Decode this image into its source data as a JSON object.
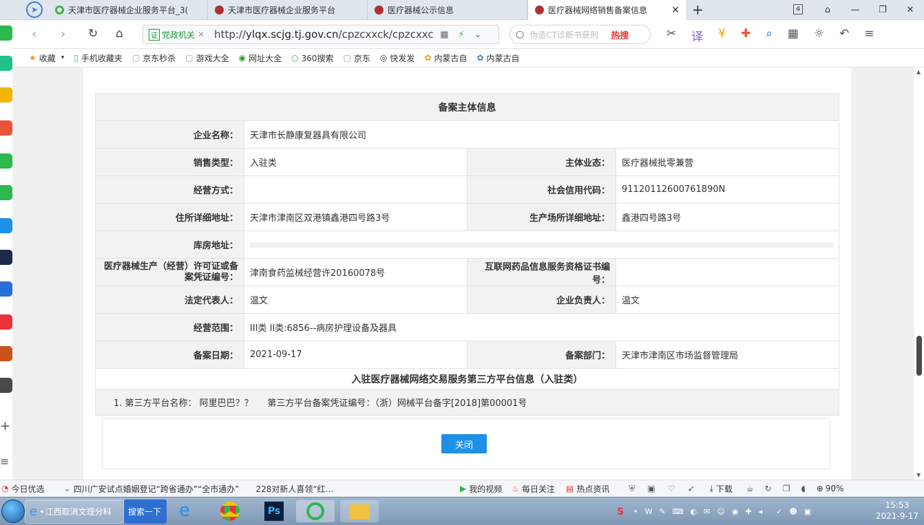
{
  "browser": {
    "tabs": [
      {
        "label": "天津市医疗器械企业服务平台_3(",
        "icon": "green-circle-icon",
        "active": false
      },
      {
        "label": "天津市医疗器械企业服务平台",
        "icon": "gov-emblem-icon",
        "active": false
      },
      {
        "label": "医疗器械公示信息",
        "icon": "gov-emblem-icon",
        "active": false
      },
      {
        "label": "医疗器械网络销售备案信息",
        "icon": "gov-emblem-icon",
        "active": true
      }
    ],
    "tab_count": "4",
    "cert_label": "党政机关",
    "url_prefix": "http://",
    "url_domain": "ylqx.scjg.tj.gov.cn",
    "url_path": "/cpzcxxck/cpzcxxckActio",
    "search_placeholder": "伪造CT诊断书获刑",
    "search_hot": "热搜",
    "bookmarks": [
      {
        "label": "收藏",
        "icon": "star-icon"
      },
      {
        "label": "手机收藏夹",
        "icon": "phone-icon"
      },
      {
        "label": "京东秒杀",
        "icon": "page-icon"
      },
      {
        "label": "游戏大全",
        "icon": "page-icon"
      },
      {
        "label": "网址大全",
        "icon": "globe-icon"
      },
      {
        "label": "360搜索",
        "icon": "search-360-icon"
      },
      {
        "label": "京东",
        "icon": "page-icon"
      },
      {
        "label": "快发发",
        "icon": "kuaifa-icon"
      },
      {
        "label": "内蒙古自",
        "icon": "flower-icon"
      },
      {
        "label": "内蒙古自",
        "icon": "flower-icon"
      }
    ]
  },
  "record": {
    "title": "备案主体信息",
    "company_name_label": "企业名称：",
    "company_name": "天津市长静康复器具有限公司",
    "sales_type_label": "销售类型：",
    "sales_type": "入驻类",
    "business_type_label": "主体业态：",
    "business_type": "医疗器械批零兼营",
    "operation_mode_label": "经营方式：",
    "operation_mode": "",
    "credit_code_label": "社会信用代码：",
    "credit_code": "91120112600761890N",
    "address_label": "住所详细地址：",
    "address": "天津市津南区双港镇鑫港四号路3号",
    "production_address_label": "生产场所详细地址：",
    "production_address": "鑫港四号路3号",
    "warehouse_label": "库房地址：",
    "warehouse": "",
    "license_label": "医疗器械生产（经营）许可证或备案凭证编号：",
    "license": "津南食药监械经营许20160078号",
    "internet_cert_label": "互联网药品信息服务资格证书编号：",
    "internet_cert": "",
    "legal_rep_label": "法定代表人：",
    "legal_rep": "温文",
    "principal_label": "企业负责人：",
    "principal": "温文",
    "scope_label": "经营范围：",
    "scope": "III类 II类:6856--病房护理设备及器具",
    "record_date_label": "备案日期：",
    "record_date": "2021-09-17",
    "record_dept_label": "备案部门：",
    "record_dept": "天津市津南区市场监督管理局",
    "platform_title": "入驻医疗器械网络交易服务第三方平台信息（入驻类）",
    "platform_line": "1. 第三方平台名称： 阿里巴巴？？     第三方平台备案凭证编号：（浙）网械平台备字[2018]第00001号",
    "close_label": "关闭"
  },
  "statusbar": {
    "news1": "今日优选",
    "news2": "四川广安试点婚姻登记“跨省通办”“全市通办”",
    "news3": "228对新人喜领“红...",
    "video": "我的视频",
    "daily": "每日关注",
    "hot": "热点资讯",
    "download": "下载",
    "zoom": "90%"
  },
  "taskbar": {
    "ie_task": "江西取消文理分科",
    "search_task": "搜索一下",
    "time": "15:53",
    "date": "2021-9-17"
  },
  "colors": {
    "accent": "#1e90e8",
    "label_bg": "#f2f2f2",
    "page_bg": "#f0f0f0"
  }
}
